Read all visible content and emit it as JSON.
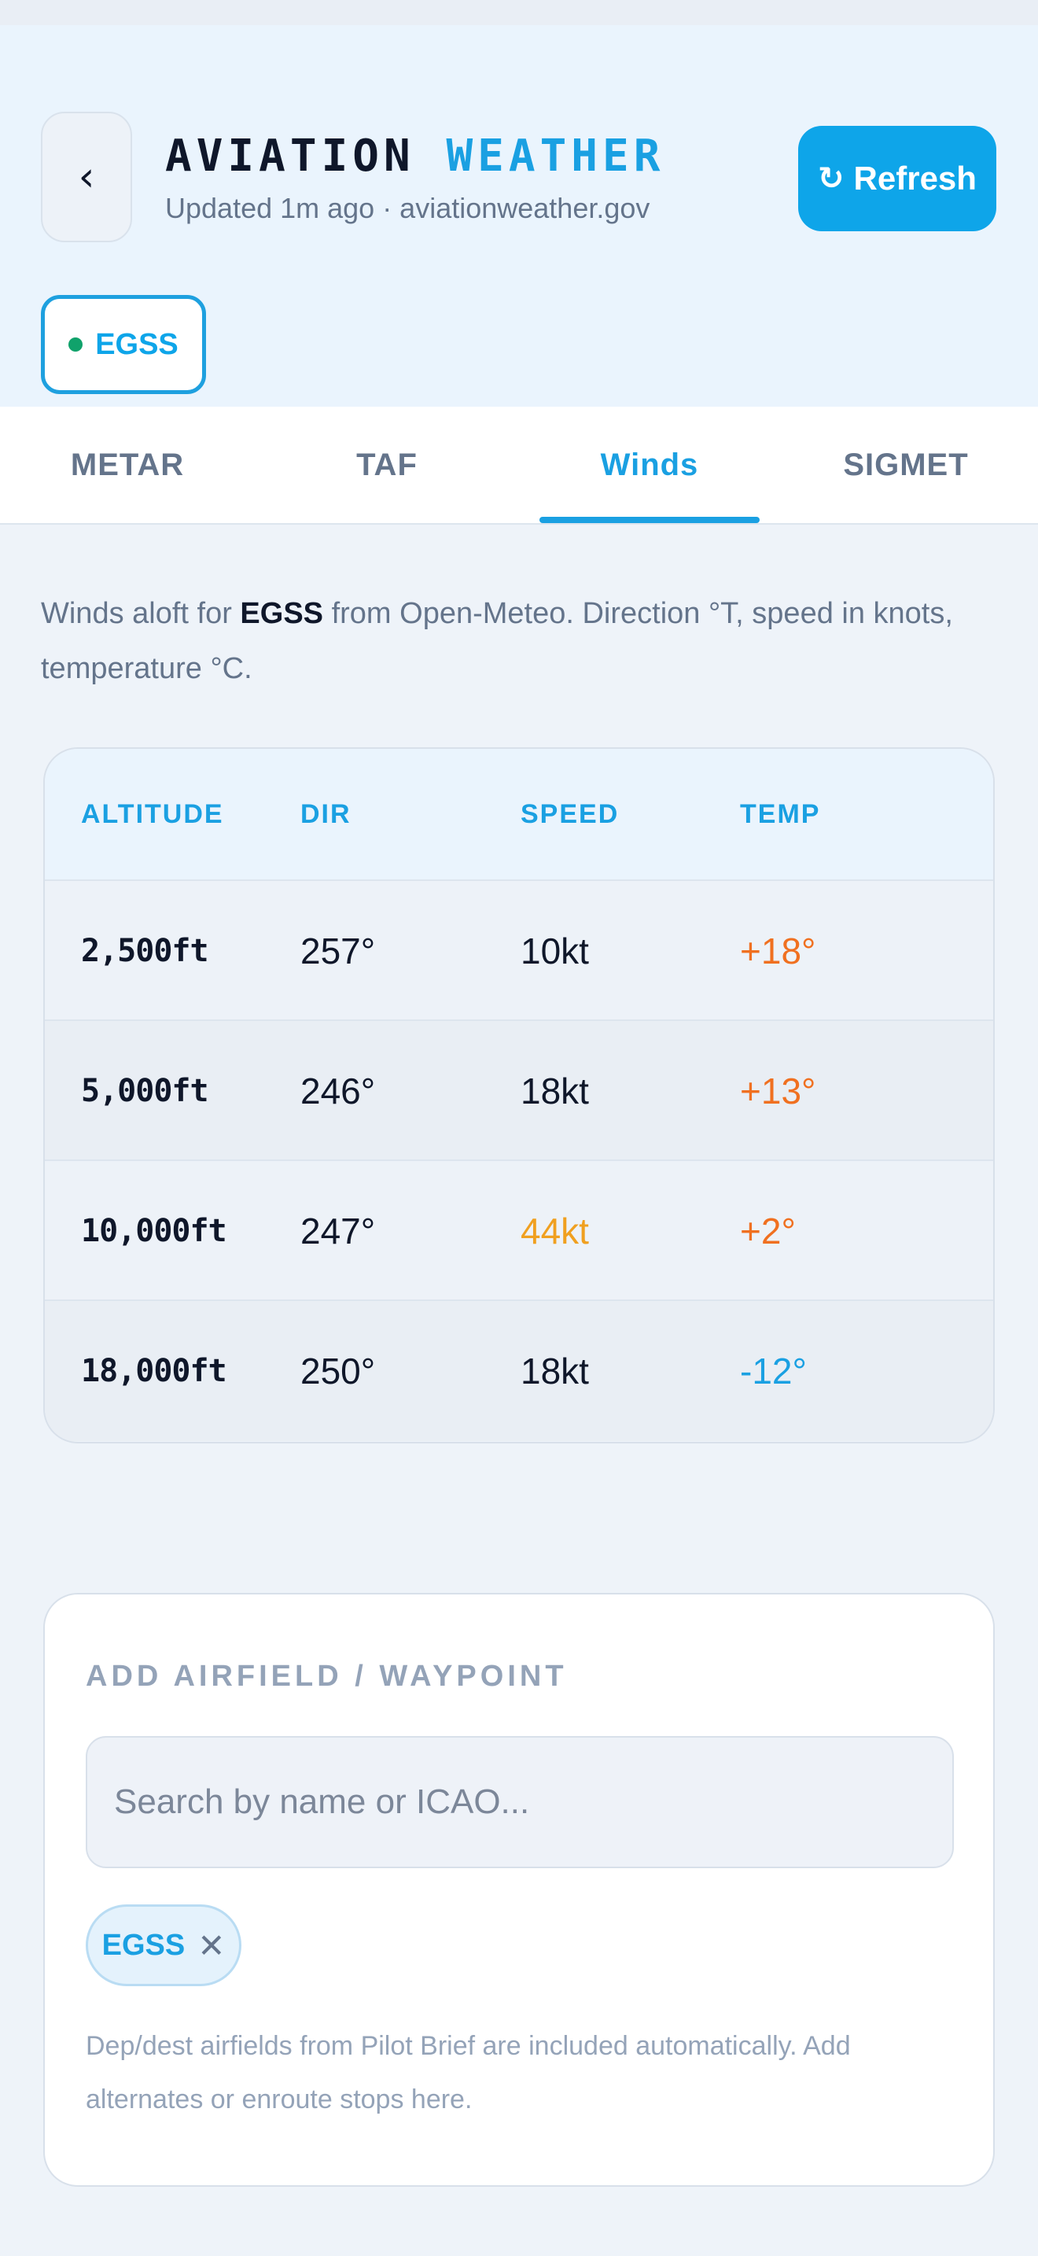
{
  "header": {
    "title_part1": "AVIATION",
    "title_part2": "WEATHER",
    "subtitle": "Updated 1m ago · aviationweather.gov",
    "back_icon": "‹",
    "refresh_icon": "↻",
    "refresh_label": "Refresh"
  },
  "station": {
    "code": "EGSS",
    "status_color": "#10a26b"
  },
  "tabs": [
    {
      "label": "METAR",
      "active": false
    },
    {
      "label": "TAF",
      "active": false
    },
    {
      "label": "Winds",
      "active": true
    },
    {
      "label": "SIGMET",
      "active": false
    }
  ],
  "intro": {
    "prefix": "Winds aloft for ",
    "station": "EGSS",
    "suffix": " from Open-Meteo. Direction °T, speed in knots, temperature °C."
  },
  "winds": {
    "headers": [
      "ALTITUDE",
      "DIR",
      "SPEED",
      "TEMP"
    ],
    "rows": [
      {
        "altitude": "2,500ft",
        "dir": "257°",
        "speed": "10kt",
        "temp": "+18°",
        "speed_color": "#0f172a",
        "temp_color": "#f07020"
      },
      {
        "altitude": "5,000ft",
        "dir": "246°",
        "speed": "18kt",
        "temp": "+13°",
        "speed_color": "#0f172a",
        "temp_color": "#f07020"
      },
      {
        "altitude": "10,000ft",
        "dir": "247°",
        "speed": "44kt",
        "temp": "+2°",
        "speed_color": "#f0a020",
        "temp_color": "#f07020"
      },
      {
        "altitude": "18,000ft",
        "dir": "250°",
        "speed": "18kt",
        "temp": "-12°",
        "speed_color": "#0f172a",
        "temp_color": "#1aa0e2"
      }
    ]
  },
  "add_airfield": {
    "title": "ADD AIRFIELD / WAYPOINT",
    "placeholder": "Search by name or ICAO...",
    "chip": "EGSS",
    "chip_remove_icon": "✕",
    "help": "Dep/dest airfields from Pilot Brief are included automatically. Add alternates or enroute stops here."
  },
  "colors": {
    "accent": "#1aa0e2",
    "header_bg": "#eaf4fd",
    "page_bg": "#eef3f9"
  }
}
